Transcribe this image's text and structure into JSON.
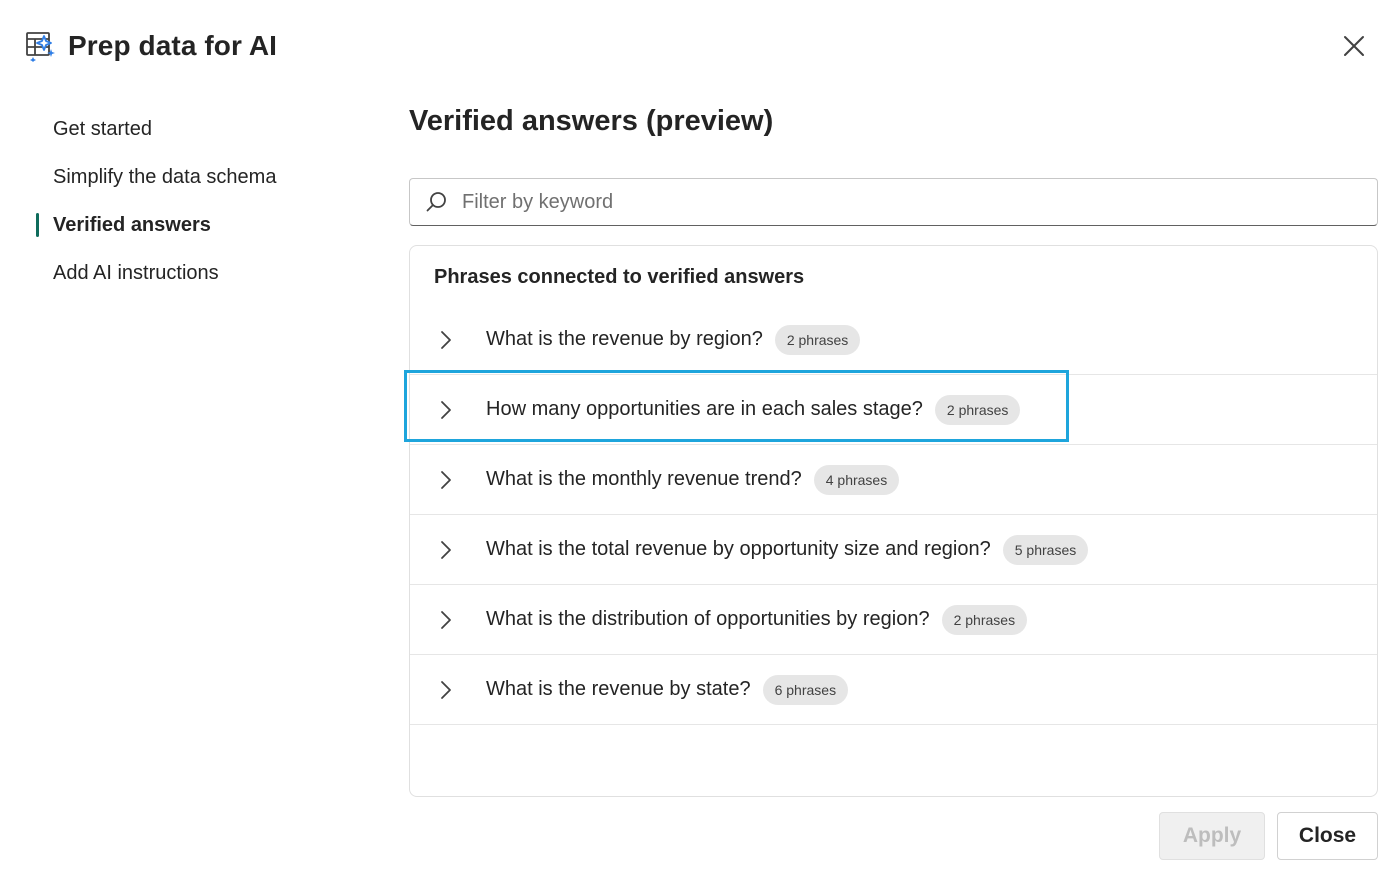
{
  "dialog": {
    "title": "Prep data for AI",
    "icon": "prep-data-ai-icon",
    "close_icon": "close-icon"
  },
  "sidebar": {
    "items": [
      {
        "label": "Get started",
        "active": false
      },
      {
        "label": "Simplify the data schema",
        "active": false
      },
      {
        "label": "Verified answers",
        "active": true
      },
      {
        "label": "Add AI instructions",
        "active": false
      }
    ],
    "active_indicator_color": "#0f6c5c"
  },
  "main": {
    "title": "Verified answers (preview)",
    "search": {
      "placeholder": "Filter by keyword",
      "value": "",
      "icon": "search-icon"
    },
    "panel": {
      "title": "Phrases connected to verified answers",
      "rows": [
        {
          "question": "What is the revenue by region?",
          "badge": "2 phrases"
        },
        {
          "question": "How many opportunities are in each sales stage?",
          "badge": "2 phrases",
          "highlighted": true
        },
        {
          "question": "What is the monthly revenue trend?",
          "badge": "4 phrases"
        },
        {
          "question": "What is the total revenue by opportunity size and region?",
          "badge": "5 phrases"
        },
        {
          "question": "What is the distribution of opportunities by region?",
          "badge": "2 phrases"
        },
        {
          "question": "What is the revenue by state?",
          "badge": "6 phrases"
        }
      ]
    },
    "highlight_color": "#1ea5dc"
  },
  "footer": {
    "apply_label": "Apply",
    "apply_disabled": true,
    "close_label": "Close"
  }
}
